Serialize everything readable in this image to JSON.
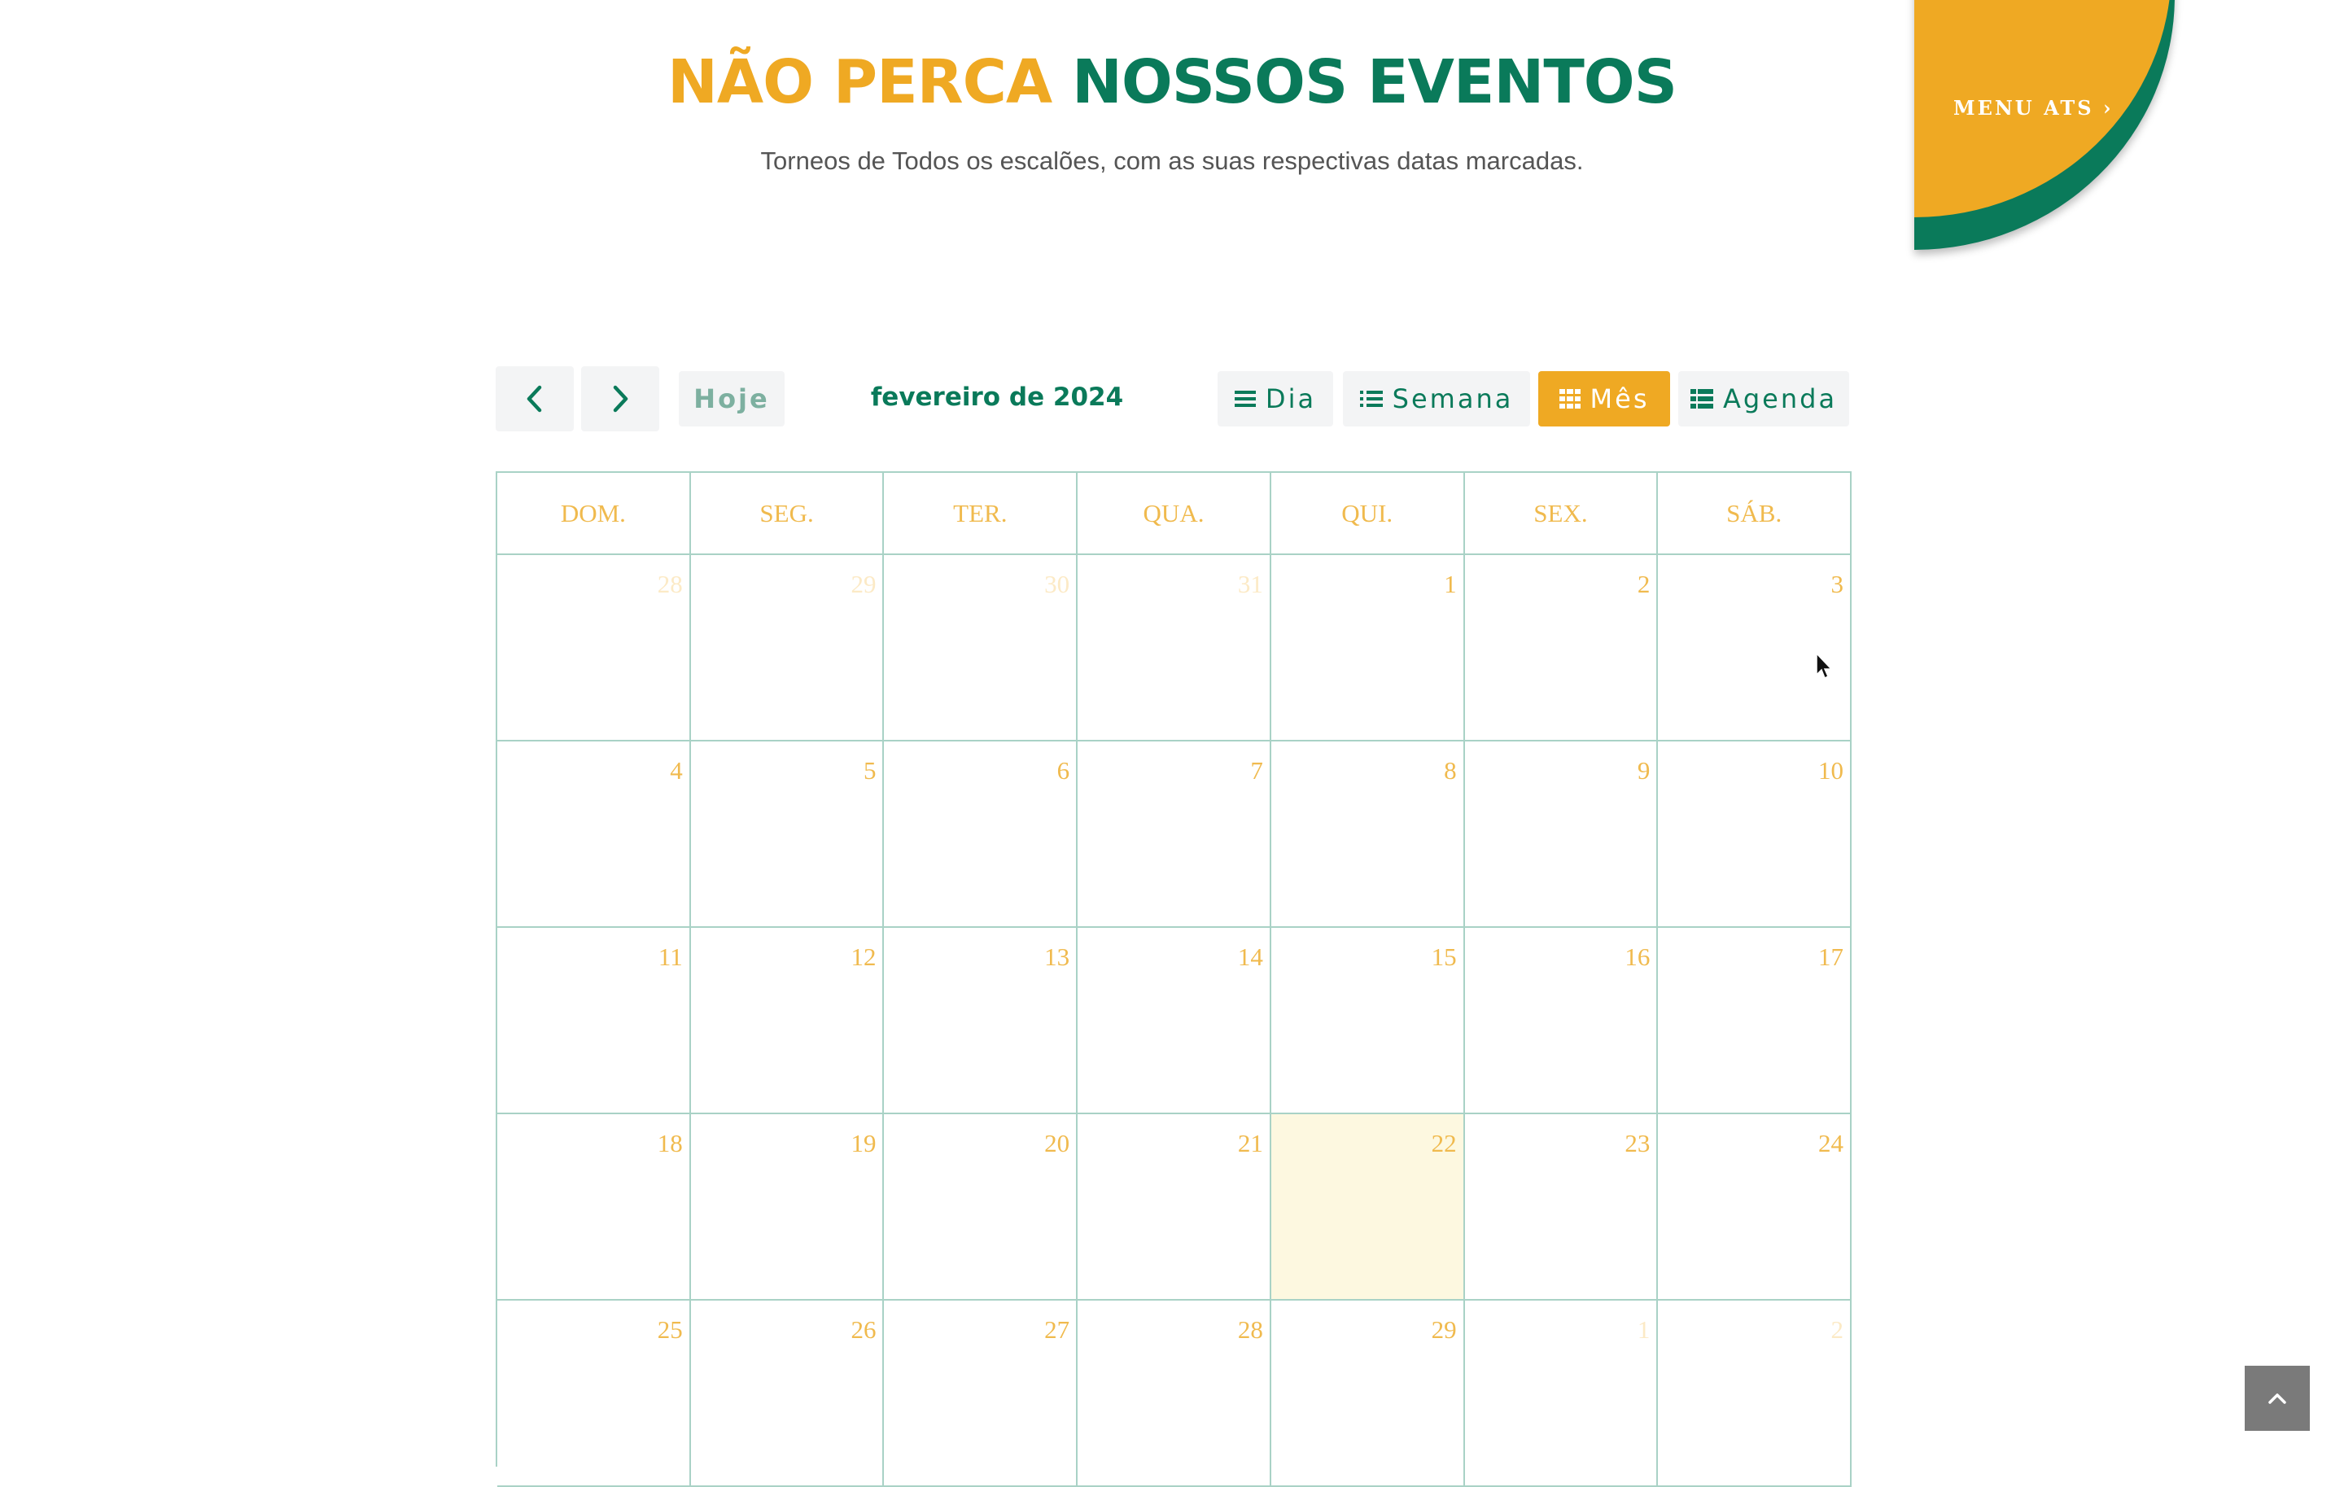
{
  "header": {
    "title_part1": "NÃO PERCA",
    "title_part2": "NOSSOS EVENTOS",
    "subtitle": "Torneos de Todos os escalões, com as suas respectivas datas marcadas."
  },
  "menu": {
    "label": "MENU ATS ›"
  },
  "toolbar": {
    "prev_icon": "chevron-left-icon",
    "next_icon": "chevron-right-icon",
    "today_label": "Hoje",
    "period_title": "fevereiro de 2024",
    "views": [
      {
        "label": "Dia",
        "icon": "list-icon",
        "active": false
      },
      {
        "label": "Semana",
        "icon": "list-bullets-icon",
        "active": false
      },
      {
        "label": "Mês",
        "icon": "grid-icon",
        "active": true
      },
      {
        "label": "Agenda",
        "icon": "table-icon",
        "active": false
      }
    ]
  },
  "calendar": {
    "weekdays": [
      "DOM.",
      "SEG.",
      "TER.",
      "QUA.",
      "QUI.",
      "SEX.",
      "SÁB."
    ],
    "today": "22",
    "weeks": [
      [
        {
          "d": "28",
          "other": true
        },
        {
          "d": "29",
          "other": true
        },
        {
          "d": "30",
          "other": true
        },
        {
          "d": "31",
          "other": true
        },
        {
          "d": "1"
        },
        {
          "d": "2"
        },
        {
          "d": "3"
        }
      ],
      [
        {
          "d": "4"
        },
        {
          "d": "5"
        },
        {
          "d": "6"
        },
        {
          "d": "7"
        },
        {
          "d": "8"
        },
        {
          "d": "9"
        },
        {
          "d": "10"
        }
      ],
      [
        {
          "d": "11"
        },
        {
          "d": "12"
        },
        {
          "d": "13"
        },
        {
          "d": "14"
        },
        {
          "d": "15"
        },
        {
          "d": "16"
        },
        {
          "d": "17"
        }
      ],
      [
        {
          "d": "18"
        },
        {
          "d": "19"
        },
        {
          "d": "20"
        },
        {
          "d": "21"
        },
        {
          "d": "22",
          "today": true
        },
        {
          "d": "23"
        },
        {
          "d": "24"
        }
      ],
      [
        {
          "d": "25"
        },
        {
          "d": "26"
        },
        {
          "d": "27"
        },
        {
          "d": "28"
        },
        {
          "d": "29"
        },
        {
          "d": "1",
          "other": true
        },
        {
          "d": "2",
          "other": true
        }
      ]
    ]
  },
  "colors": {
    "orange": "#EFA923",
    "green": "#0A7A5A",
    "grid": "#A9D2C6",
    "today_bg": "#FDF8E0"
  },
  "scroll_top_icon": "chevron-up-icon"
}
